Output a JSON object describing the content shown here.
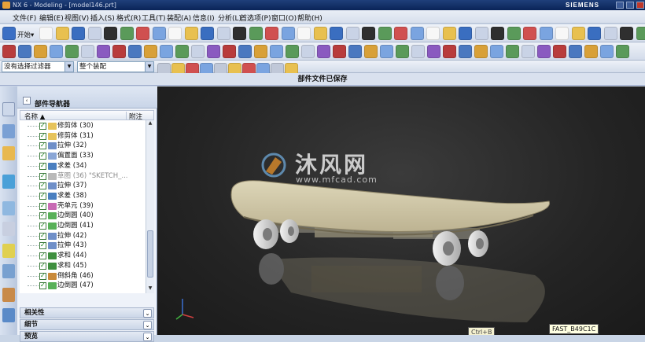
{
  "window": {
    "title": "NX 6 - Modeling - [model146.prt]",
    "brand": "SIEMENS"
  },
  "menu": [
    "文件(F)",
    "编辑(E)",
    "视图(V)",
    "插入(S)",
    "格式(R)",
    "工具(T)",
    "装配(A)",
    "信息(I)",
    "分析(L)",
    "首选项(P)",
    "窗口(O)",
    "帮助(H)"
  ],
  "toolbar": {
    "start_label": "开始▾"
  },
  "selection": {
    "filter": "没有选择过滤器",
    "scope": "整个装配"
  },
  "status": {
    "text": "部件文件已保存"
  },
  "navigator": {
    "title": "部件导航器",
    "col_name": "名称",
    "col_note": "附注",
    "rows": [
      {
        "label": "修剪体 (30)",
        "icon_color": "#e6c35a"
      },
      {
        "label": "修剪体 (31)",
        "icon_color": "#e6c35a"
      },
      {
        "label": "拉伸 (32)",
        "icon_color": "#6f8fc8"
      },
      {
        "label": "偏置面 (33)",
        "icon_color": "#8aa6d6"
      },
      {
        "label": "求差 (34)",
        "icon_color": "#4a7fc0"
      },
      {
        "label": "草图 (36) \"SKETCH_...",
        "icon_color": "#b9b9b9",
        "dim": true
      },
      {
        "label": "拉伸 (37)",
        "icon_color": "#6f8fc8"
      },
      {
        "label": "求差 (38)",
        "icon_color": "#4a7fc0"
      },
      {
        "label": "壳单元 (39)",
        "icon_color": "#c86ab4"
      },
      {
        "label": "边倒圆 (40)",
        "icon_color": "#58b058"
      },
      {
        "label": "边倒圆 (41)",
        "icon_color": "#58b058"
      },
      {
        "label": "拉伸 (42)",
        "icon_color": "#6f8fc8"
      },
      {
        "label": "拉伸 (43)",
        "icon_color": "#6f8fc8"
      },
      {
        "label": "求和 (44)",
        "icon_color": "#3f8f3f"
      },
      {
        "label": "求和 (45)",
        "icon_color": "#3f8f3f"
      },
      {
        "label": "倒斜角 (46)",
        "icon_color": "#c98a3a"
      },
      {
        "label": "边倒圆 (47)",
        "icon_color": "#58b058"
      }
    ],
    "panels": [
      "相关性",
      "细节",
      "预览"
    ]
  },
  "watermark": {
    "site": "沐风网",
    "url": "www.mfcad.com"
  },
  "tooltip": {
    "fast": "FAST_B49C1C",
    "shortcut": "Ctrl+B"
  }
}
